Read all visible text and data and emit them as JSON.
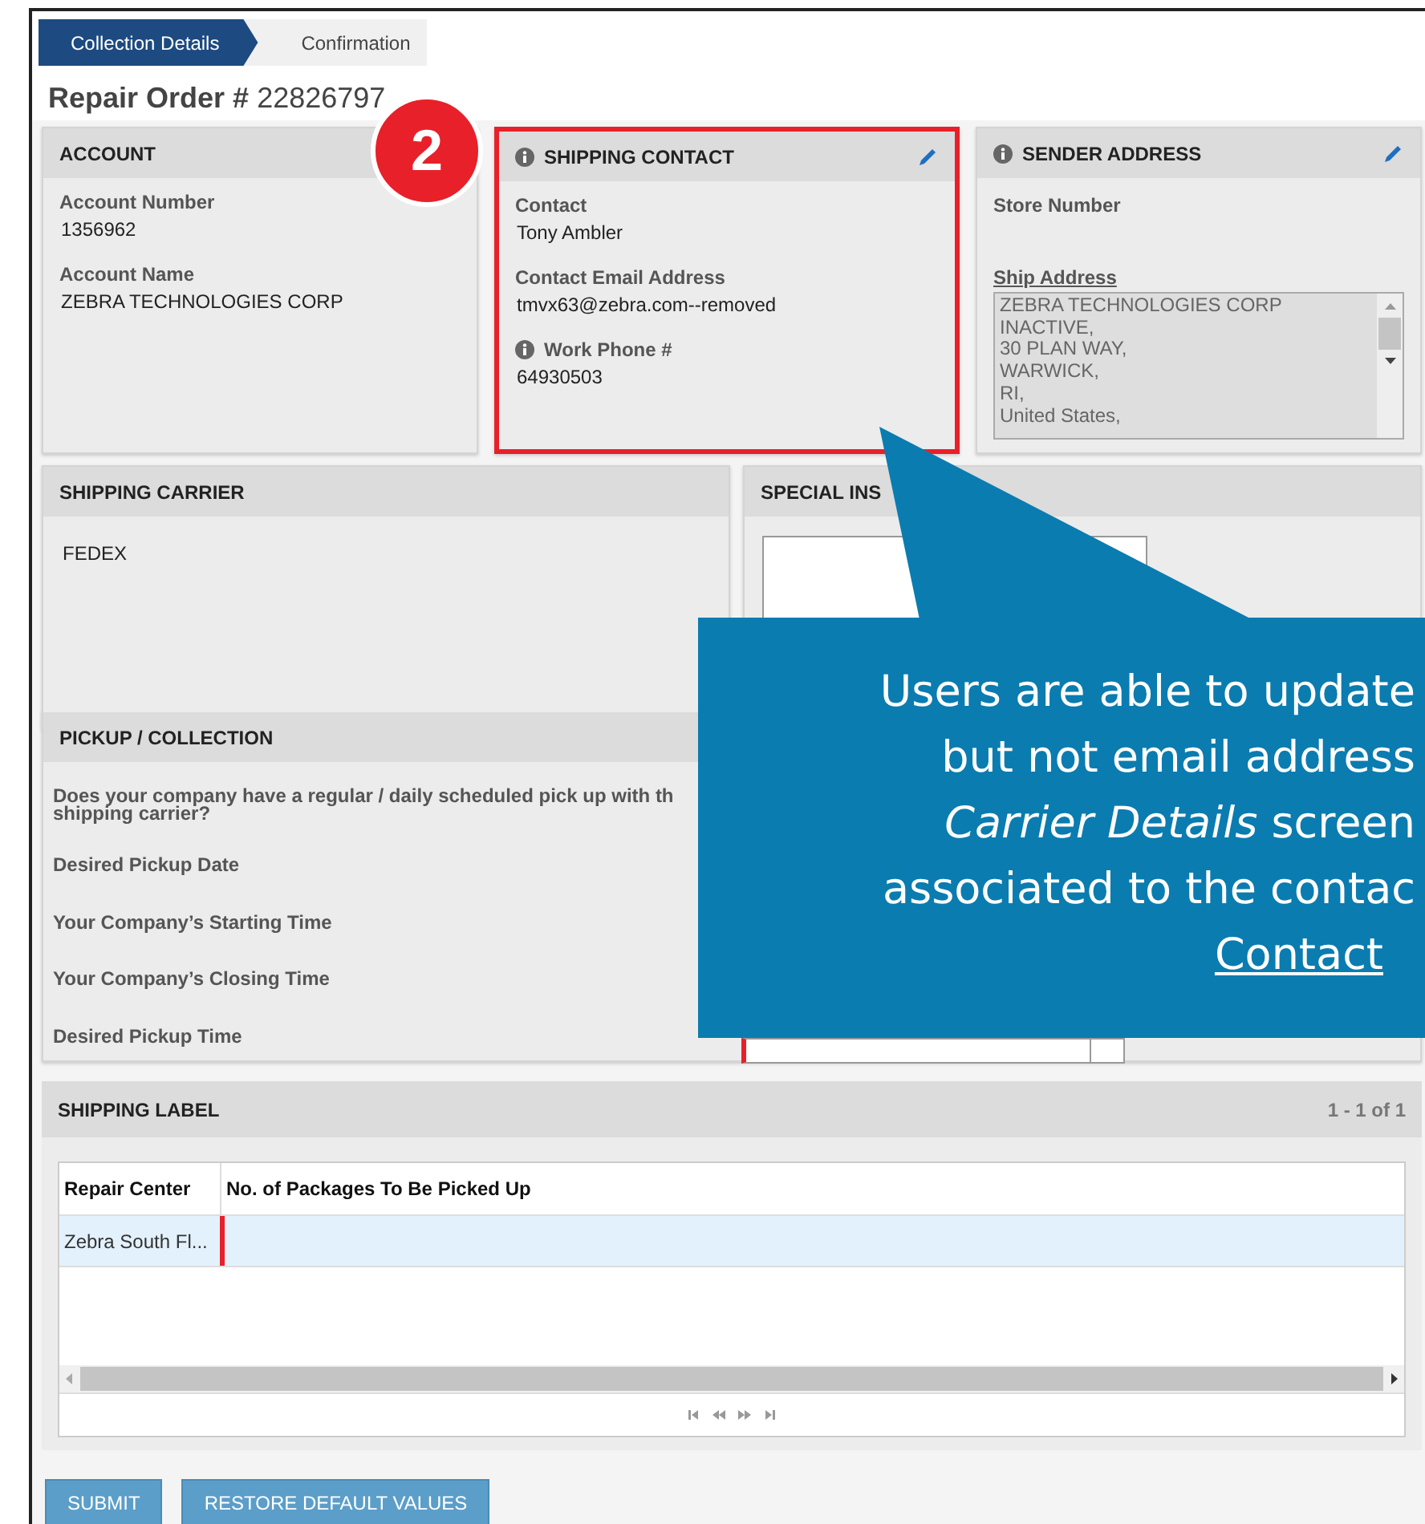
{
  "steps": [
    {
      "label": "Collection Details",
      "selected": true
    },
    {
      "label": "Confirmation",
      "selected": false
    }
  ],
  "title": {
    "label": "Repair Order #",
    "number": "22826797"
  },
  "step_badge": "2",
  "account": {
    "title": "ACCOUNT",
    "fields": [
      {
        "label": "Account Number",
        "value": "1356962",
        "info": false
      },
      {
        "label": "Account Name",
        "value": "ZEBRA TECHNOLOGIES CORP",
        "info": false
      }
    ]
  },
  "shipping_contact": {
    "title": "SHIPPING CONTACT",
    "info": true,
    "editable": true,
    "highlighted": true,
    "fields": [
      {
        "label": "Contact",
        "value": "Tony Ambler",
        "info": false
      },
      {
        "label": "Contact Email Address",
        "value": "tmvx63@zebra.com--removed",
        "info": false
      },
      {
        "label": "Work Phone #",
        "value": "64930503",
        "info": true
      }
    ]
  },
  "sender_address": {
    "title": "SENDER ADDRESS",
    "info": true,
    "editable": true,
    "store_number_label": "Store Number",
    "ship_address_label": "Ship Address",
    "ship_address_lines": [
      "ZEBRA TECHNOLOGIES CORP",
      "INACTIVE,",
      "30 PLAN WAY,",
      "WARWICK,",
      "RI,",
      "United States,"
    ]
  },
  "shipping_carrier": {
    "title": "SHIPPING CARRIER",
    "value": "FEDEX"
  },
  "special_instructions": {
    "title": "SPECIAL INS"
  },
  "pickup": {
    "title": "PICKUP / COLLECTION",
    "question": [
      "Does your company have a regular / daily scheduled pick up with th",
      "shipping carrier?"
    ],
    "field_labels": [
      "Desired Pickup Date",
      "Your Company’s Starting Time",
      "Your Company’s Closing Time",
      "Desired Pickup Time"
    ],
    "pickup_time_dropdown": {
      "required": true
    }
  },
  "shipping_label": {
    "title": "SHIPPING LABEL",
    "count": "1 - 1 of 1",
    "columns": [
      "Repair Center",
      "No. of Packages To Be Picked Up"
    ],
    "rows": [
      {
        "repair_center": "Zebra South Fl...",
        "selected": true,
        "required": true
      }
    ]
  },
  "buttons": [
    "SUBMIT",
    "RESTORE DEFAULT VALUES"
  ],
  "callout": {
    "lines": [
      {
        "kind": "text",
        "text": "Users are able to update"
      },
      {
        "kind": "text",
        "text": "but not email address"
      },
      {
        "kind": "text",
        "text": "*Carrier Details* screen"
      },
      {
        "kind": "text",
        "text": "associated to the contac"
      },
      {
        "kind": "link",
        "text": "Contact"
      }
    ]
  }
}
